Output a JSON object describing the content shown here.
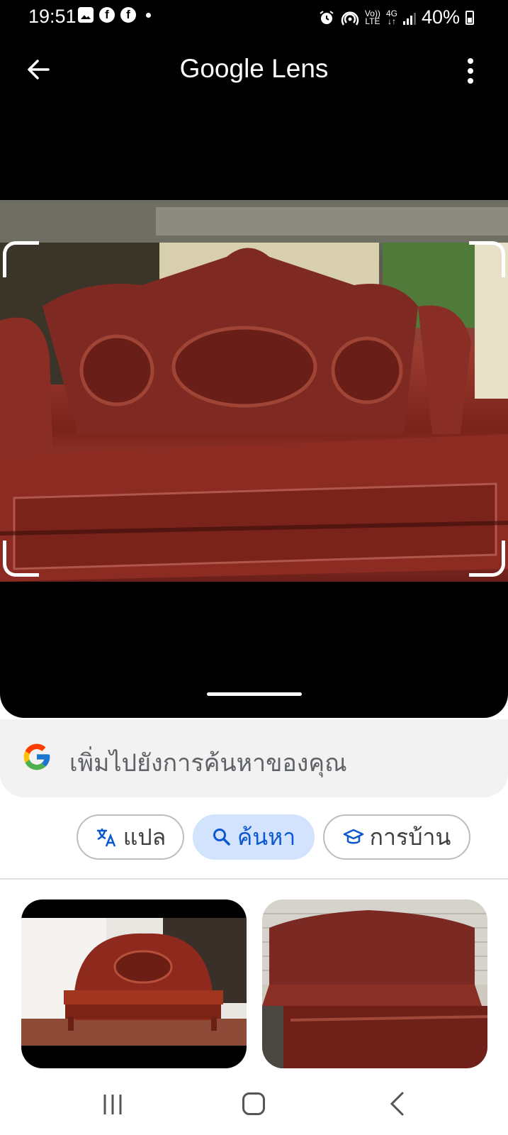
{
  "status_bar": {
    "time": "19:51",
    "network_top": "Vo))",
    "network_bottom": "LTE",
    "data_top": "4G",
    "data_bottom": "↓↑",
    "battery": "40%",
    "icons": [
      "gallery-icon",
      "facebook-icon",
      "facebook-icon",
      "dot-icon",
      "alarm-icon",
      "hotspot-icon",
      "volte-icon",
      "4g-icon",
      "signal-icon",
      "battery-icon"
    ]
  },
  "app_bar": {
    "title": "Google Lens",
    "icons": [
      "back-arrow-icon",
      "more-vert-icon"
    ]
  },
  "search": {
    "placeholder": "เพิ่มไปยังการค้นหาของคุณ"
  },
  "chips": [
    {
      "label": "แปล",
      "icon": "translate-icon",
      "active": false
    },
    {
      "label": "ค้นหา",
      "icon": "search-icon",
      "active": true
    },
    {
      "label": "การบ้าน",
      "icon": "graduation-cap-icon",
      "active": false
    }
  ],
  "colors": {
    "accent": "#0b57d0",
    "chip_active_bg": "#d3e3fd",
    "dark_bg": "#000000",
    "wood": "#8c2a20"
  },
  "nav_bar": {
    "icons": [
      "recent-apps-icon",
      "home-icon",
      "back-icon"
    ]
  }
}
